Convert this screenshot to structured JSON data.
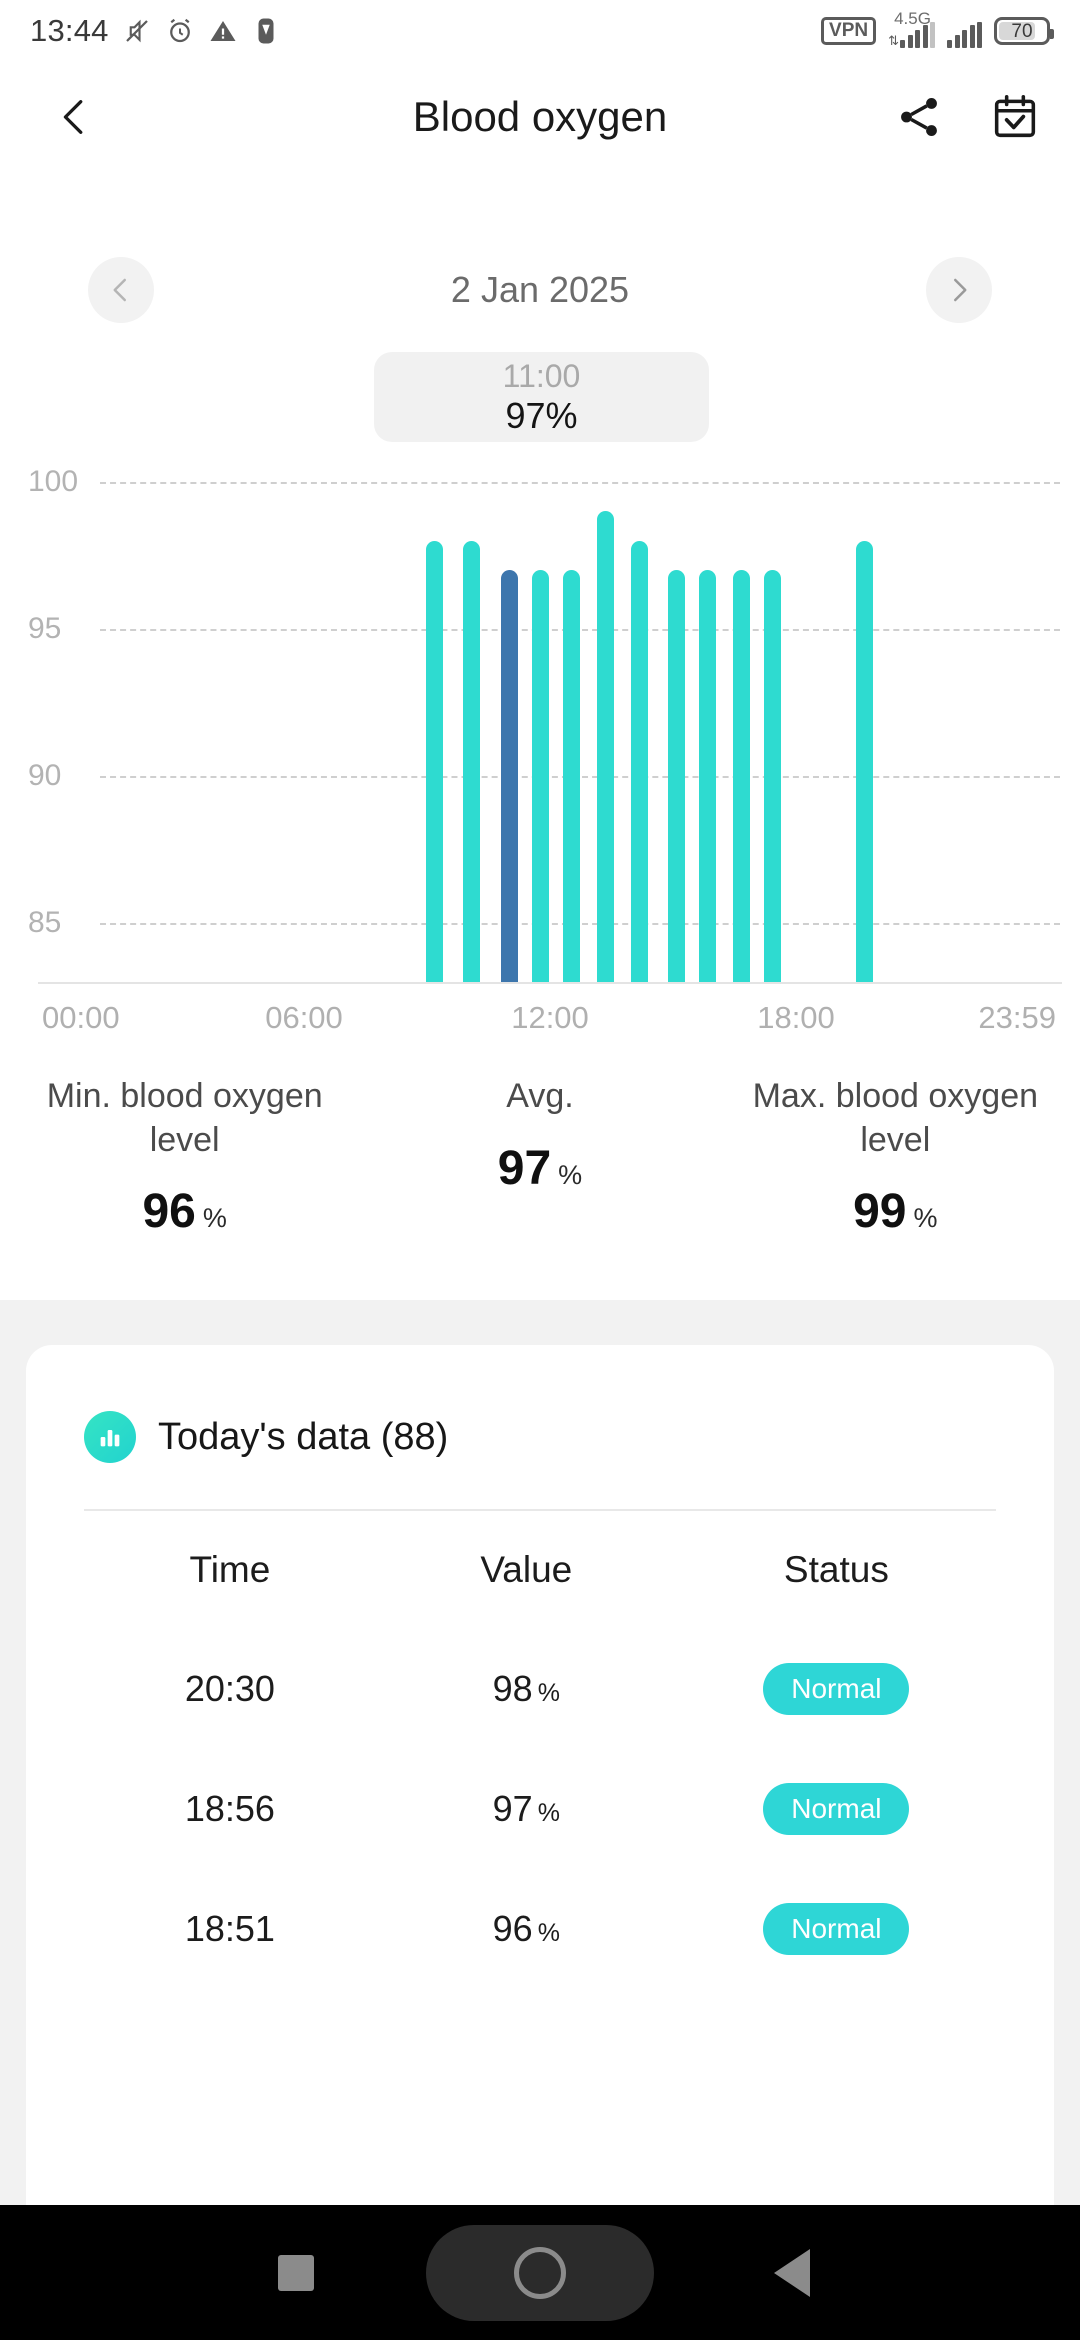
{
  "statusbar": {
    "time": "13:44",
    "icons": [
      "mute-icon",
      "alarm-icon",
      "warning-icon",
      "shield-icon"
    ],
    "vpn": "VPN",
    "network": "4.5G",
    "battery": "70"
  },
  "header": {
    "title": "Blood oxygen",
    "back_icon": "back-chevron-icon",
    "share_icon": "share-icon",
    "calendar_icon": "calendar-check-icon"
  },
  "datenav": {
    "prev_icon": "chevron-left-icon",
    "next_icon": "chevron-right-icon",
    "date": "2 Jan 2025"
  },
  "tooltip": {
    "time": "11:00",
    "value": "97%"
  },
  "chart_data": {
    "type": "bar",
    "title": "Blood oxygen",
    "xlabel": "",
    "ylabel": "%",
    "ylim": [
      83,
      100
    ],
    "yticks": [
      100,
      95,
      90,
      85
    ],
    "ytick_labels": [
      "100",
      "95",
      "90",
      "85"
    ],
    "xlim": [
      "00:00",
      "23:59"
    ],
    "xticks": [
      "00:00",
      "06:00",
      "12:00",
      "18:00",
      "23:59"
    ],
    "grid": true,
    "legend": "none",
    "bar_color": "#2edbd0",
    "selected_color": "#3d76ad",
    "selected_index": 2,
    "x": [
      "09:10",
      "10:05",
      "11:00",
      "11:45",
      "12:30",
      "13:20",
      "14:10",
      "15:05",
      "15:50",
      "16:40",
      "17:25",
      "19:40"
    ],
    "values": [
      98,
      98,
      97,
      97,
      97,
      99,
      98,
      97,
      97,
      97,
      97,
      98
    ]
  },
  "stats": [
    {
      "label": "Min. blood oxygen level",
      "value": "96",
      "unit": "%"
    },
    {
      "label": "Avg.",
      "value": "97",
      "unit": "%"
    },
    {
      "label": "Max. blood oxygen level",
      "value": "99",
      "unit": "%"
    }
  ],
  "card": {
    "icon": "bar-chart-icon",
    "title": "Today's data (88)",
    "columns": [
      "Time",
      "Value",
      "Status"
    ],
    "rows": [
      {
        "time": "20:30",
        "value": "98",
        "unit": "%",
        "status": "Normal"
      },
      {
        "time": "18:56",
        "value": "97",
        "unit": "%",
        "status": "Normal"
      },
      {
        "time": "18:51",
        "value": "96",
        "unit": "%",
        "status": "Normal"
      }
    ]
  },
  "navbar": {
    "recent_icon": "recents-square-icon",
    "home_icon": "home-circle-icon",
    "back_icon": "back-triangle-icon"
  }
}
